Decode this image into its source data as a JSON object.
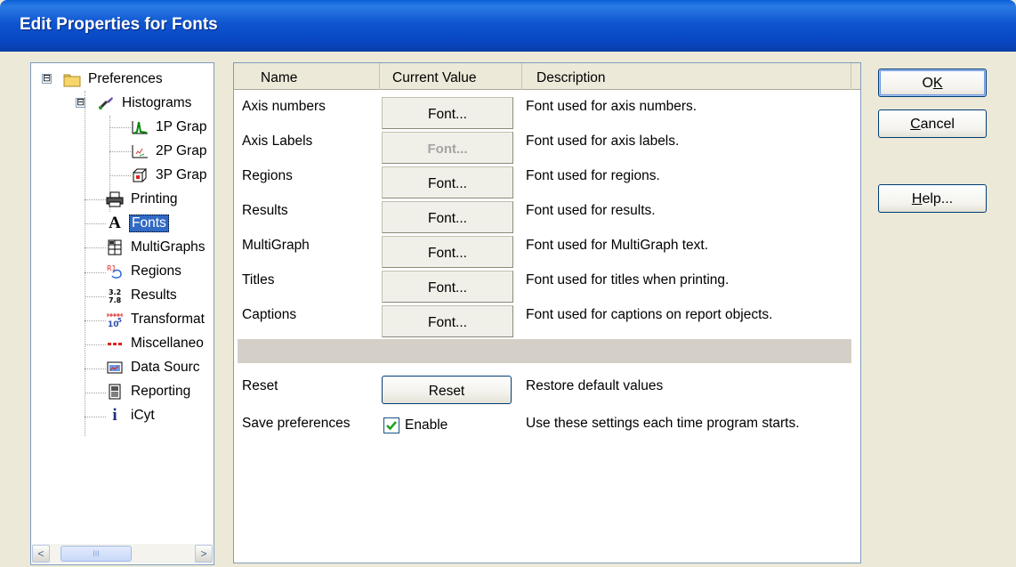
{
  "window": {
    "title": "Edit Properties for Fonts"
  },
  "tree": {
    "root": {
      "label": "Preferences",
      "expander": "⊟"
    },
    "histograms": {
      "label": "Histograms",
      "expander": "⊟"
    },
    "items": [
      {
        "label": "1P Grap",
        "icon": "1p-graph-icon"
      },
      {
        "label": "2P Grap",
        "icon": "2p-graph-icon"
      },
      {
        "label": "3P Grap",
        "icon": "3p-graph-icon"
      },
      {
        "label": "Printing",
        "icon": "printer-icon"
      },
      {
        "label": "Fonts",
        "icon": "font-icon",
        "selected": true
      },
      {
        "label": "MultiGraphs",
        "icon": "multigraph-icon"
      },
      {
        "label": "Regions",
        "icon": "regions-icon"
      },
      {
        "label": "Results",
        "icon": "results-icon"
      },
      {
        "label": "Transformat",
        "icon": "transformation-icon"
      },
      {
        "label": "Miscellaneo",
        "icon": "miscellaneous-icon"
      },
      {
        "label": "Data Sourc",
        "icon": "data-source-icon"
      },
      {
        "label": "Reporting",
        "icon": "reporting-icon"
      },
      {
        "label": "iCyt",
        "icon": "info-icon"
      }
    ],
    "scroll": {
      "left": "<",
      "right": ">",
      "grip": "III"
    }
  },
  "grid": {
    "headers": {
      "name": "Name",
      "value": "Current Value",
      "description": "Description"
    },
    "rows": [
      {
        "name": "Axis numbers",
        "button": "Font...",
        "description": "Font used for axis numbers.",
        "disabled": false
      },
      {
        "name": "Axis Labels",
        "button": "Font...",
        "description": "Font used for axis labels.",
        "disabled": true
      },
      {
        "name": "Regions",
        "button": "Font...",
        "description": "Font used for regions.",
        "disabled": false
      },
      {
        "name": "Results",
        "button": "Font...",
        "description": "Font used for results.",
        "disabled": false
      },
      {
        "name": "MultiGraph",
        "button": "Font...",
        "description": "Font used for MultiGraph text.",
        "disabled": false
      },
      {
        "name": "Titles",
        "button": "Font...",
        "description": "Font used for titles when printing.",
        "disabled": false
      },
      {
        "name": "Captions",
        "button": "Font...",
        "description": "Font used for captions on report objects.",
        "disabled": false
      }
    ],
    "reset": {
      "name": "Reset",
      "button": "Reset",
      "description": "Restore default values"
    },
    "save": {
      "name": "Save preferences",
      "checkbox_label": "Enable",
      "checked": true,
      "description": "Use these settings each time program starts."
    }
  },
  "buttons": {
    "ok": {
      "pre": "O",
      "ul": "K",
      "post": ""
    },
    "cancel": {
      "pre": "",
      "ul": "C",
      "post": "ancel"
    },
    "help": {
      "pre": "",
      "ul": "H",
      "post": "elp..."
    }
  },
  "colors": {
    "titlebar": "#0a4fd0",
    "selection": "#316ac5",
    "dialog": "#ece9d8"
  }
}
